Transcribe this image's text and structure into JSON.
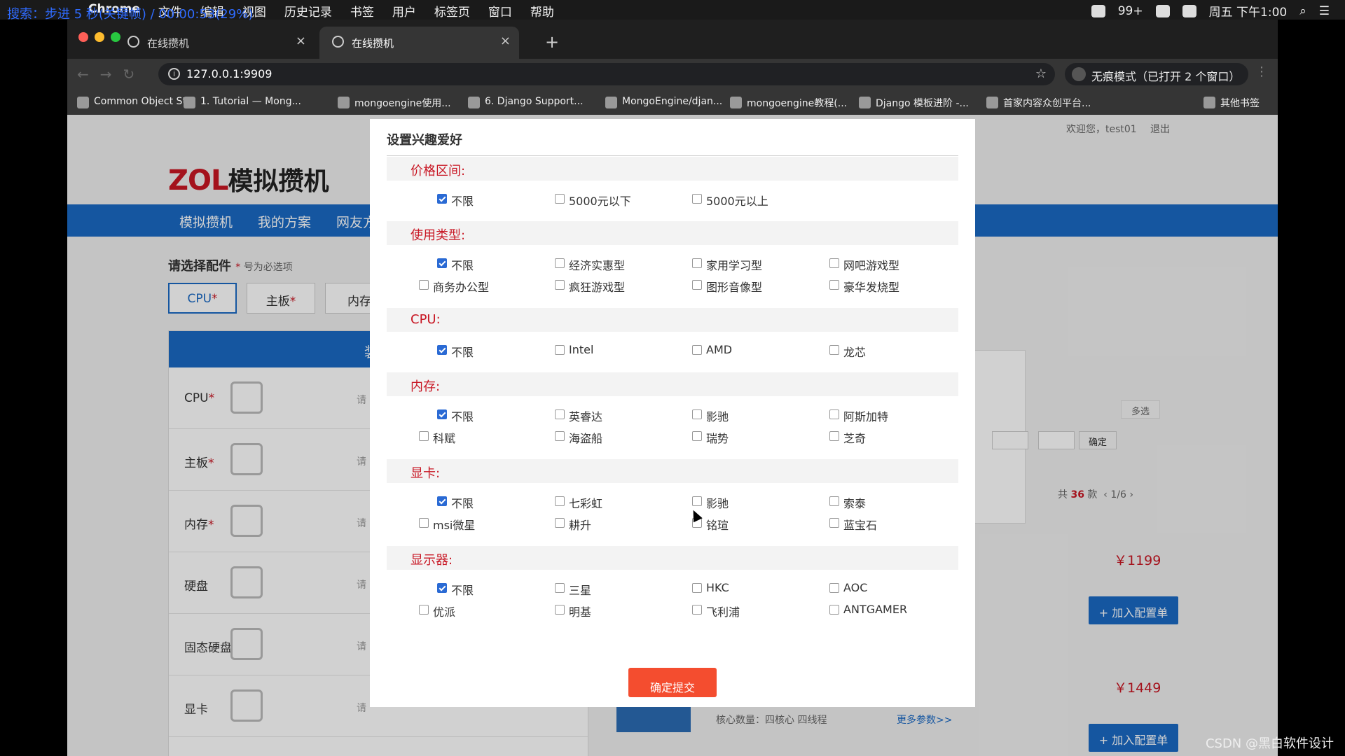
{
  "menubar": {
    "search_overlay": "搜索：步进 5 秒(关键帧) / 00:00:53(29%)",
    "app_name": "Chrome",
    "menus": [
      "文件",
      "编辑",
      "视图",
      "历史记录",
      "书签",
      "用户",
      "标签页",
      "窗口",
      "帮助"
    ],
    "notifications": "99+",
    "clock": "周五 下午1:00"
  },
  "browser": {
    "tabs": [
      {
        "title": "在线攒机"
      },
      {
        "title": "在线攒机"
      }
    ],
    "url": "127.0.0.1:9909",
    "incognito": "无痕模式（已打开 2 个窗口）",
    "bookmarks": [
      "Common Object St...",
      "1. Tutorial — Mong...",
      "mongoengine使用...",
      "6. Django Support...",
      "MongoEngine/djan...",
      "mongoengine教程(...",
      "Django 模板进阶 -...",
      "首家内容众创平台..."
    ],
    "other_bookmarks": "其他书签"
  },
  "page": {
    "welcome": "欢迎您，test01",
    "logout": "退出",
    "logo_zol": "ZOL",
    "logo_site": "模拟攒机",
    "nav": [
      "模拟攒机",
      "我的方案",
      "网友方"
    ],
    "select_parts": "请选择配件",
    "required_note": "号为必选项",
    "part_tabs": [
      "CPU",
      "主板",
      "内存"
    ],
    "panel_head": "装机",
    "parts": [
      {
        "label": "CPU",
        "required": true
      },
      {
        "label": "主板",
        "required": true
      },
      {
        "label": "内存",
        "required": true
      },
      {
        "label": "硬盘",
        "required": false
      },
      {
        "label": "固态硬盘",
        "required": false
      },
      {
        "label": "显卡",
        "required": false
      }
    ],
    "pick_label": "请",
    "multi_select": "多选",
    "range_ok": "确定",
    "pager": {
      "prefix": "共",
      "count": "36",
      "suffix": "款",
      "page": "1/6"
    },
    "prices": [
      "￥1199",
      "￥1449"
    ],
    "add_to_list": "+ 加入配置单",
    "specs": "核心数量：四核心 四线程",
    "more_params": "更多参数>>"
  },
  "modal": {
    "title": "设置兴趣爱好",
    "groups": [
      {
        "label": "价格区间:",
        "options": [
          {
            "t": "不限",
            "on": true
          },
          {
            "t": "5000元以下",
            "on": false
          },
          {
            "t": "5000元以上",
            "on": false
          }
        ]
      },
      {
        "label": "使用类型:",
        "options": [
          {
            "t": "不限",
            "on": true
          },
          {
            "t": "经济实惠型",
            "on": false
          },
          {
            "t": "家用学习型",
            "on": false
          },
          {
            "t": "网吧游戏型",
            "on": false
          },
          {
            "t": "商务办公型",
            "on": false
          },
          {
            "t": "疯狂游戏型",
            "on": false
          },
          {
            "t": "图形音像型",
            "on": false
          },
          {
            "t": "豪华发烧型",
            "on": false
          }
        ]
      },
      {
        "label": "CPU:",
        "options": [
          {
            "t": "不限",
            "on": true
          },
          {
            "t": "Intel",
            "on": false
          },
          {
            "t": "AMD",
            "on": false
          },
          {
            "t": "龙芯",
            "on": false
          }
        ]
      },
      {
        "label": "内存:",
        "options": [
          {
            "t": "不限",
            "on": true
          },
          {
            "t": "英睿达",
            "on": false
          },
          {
            "t": "影驰",
            "on": false
          },
          {
            "t": "阿斯加特",
            "on": false
          },
          {
            "t": "科赋",
            "on": false
          },
          {
            "t": "海盗船",
            "on": false
          },
          {
            "t": "瑞势",
            "on": false
          },
          {
            "t": "芝奇",
            "on": false
          }
        ]
      },
      {
        "label": "显卡:",
        "options": [
          {
            "t": "不限",
            "on": true
          },
          {
            "t": "七彩虹",
            "on": false
          },
          {
            "t": "影驰",
            "on": false
          },
          {
            "t": "索泰",
            "on": false
          },
          {
            "t": "msi微星",
            "on": false
          },
          {
            "t": "耕升",
            "on": false
          },
          {
            "t": "铭瑄",
            "on": false
          },
          {
            "t": "蓝宝石",
            "on": false
          }
        ]
      },
      {
        "label": "显示器:",
        "options": [
          {
            "t": "不限",
            "on": true
          },
          {
            "t": "三星",
            "on": false
          },
          {
            "t": "HKC",
            "on": false
          },
          {
            "t": "AOC",
            "on": false
          },
          {
            "t": "优派",
            "on": false
          },
          {
            "t": "明基",
            "on": false
          },
          {
            "t": "飞利浦",
            "on": false
          },
          {
            "t": "ANTGAMER",
            "on": false
          }
        ]
      }
    ],
    "submit": "确定提交"
  },
  "watermark": "CSDN @黑白软件设计"
}
